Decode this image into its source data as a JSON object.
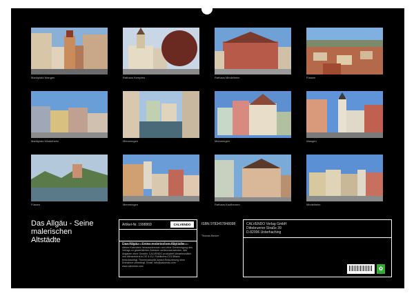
{
  "calendar": {
    "title": "Das Allgäu - Seine malerischen Altstädte",
    "photos": [
      {
        "caption": "Marktplatz Wangen"
      },
      {
        "caption": "Rathaus Kempten"
      },
      {
        "caption": "Rathaus Mindelheim"
      },
      {
        "caption": "Füssen"
      },
      {
        "caption": "Marktplatz Mindelheim"
      },
      {
        "caption": "Memmingen"
      },
      {
        "caption": "Memmingen"
      },
      {
        "caption": "Wangen"
      },
      {
        "caption": "Füssen"
      },
      {
        "caption": "Memmingen"
      },
      {
        "caption": "Rathaus Kaufbeuren"
      },
      {
        "caption": "Mindelheim"
      }
    ]
  },
  "info": {
    "article_number": "Artikel-Nr. 1998869",
    "logo_text": "CALVENDO",
    "subtitle": "Das Allgäu - Seine malerischen Altstädte",
    "body_text": "Inhalte bestehender Schutzrechte ist es untersagt, die Bilder dieses Kalenders herauszutrennen und ohne Genehmigung des Verlags zu gewerblichen Zwecken weiterzuverwenden. Alle Angaben ohne Gewähr. CALVENDO produziert klimafreundlich und klimaneutral in DE & EU. Publikums-CO2-Bilanz berücksichtigt. Themenaktuelle Ablauf-Reduzierung ohne Entnahme unbedingt. Email: info@calvendo.com · www.calvendo.com"
  },
  "isbn": {
    "isbn": "ISBN 9783457848098",
    "author": "Thomas Becker"
  },
  "publisher": {
    "name": "CALVENDO Verlag GmbH",
    "street": "Dittebrunner Straße 39",
    "city": "D-82006 Unterhaching"
  }
}
